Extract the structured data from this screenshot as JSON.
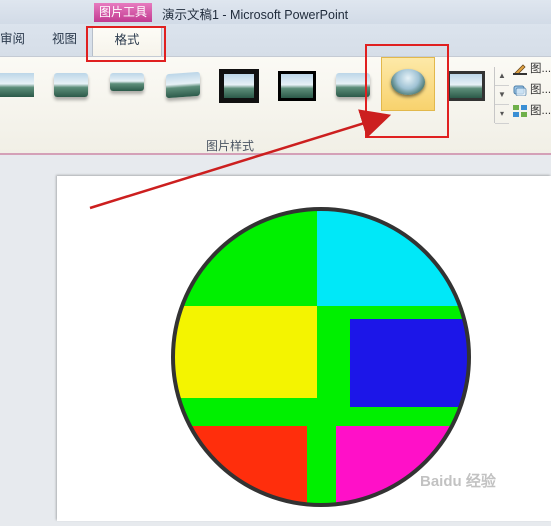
{
  "title_bar": {
    "tools_badge": "图片工具",
    "document_title": "演示文稿1 - Microsoft PowerPoint"
  },
  "tabs": [
    {
      "label": "审阅"
    },
    {
      "label": "视图"
    },
    {
      "label": "格式"
    }
  ],
  "ribbon": {
    "group_label": "图片样式",
    "right_commands": [
      {
        "label": "图..."
      },
      {
        "label": "图..."
      },
      {
        "label": "图..."
      }
    ]
  },
  "slide": {
    "shape": "circle-cropped-picture",
    "colors": {
      "green": "#00f000",
      "cyan": "#00e8f8",
      "yellow": "#f4f400",
      "blue": "#1c16e8",
      "red": "#ff2e0c",
      "magenta": "#ff10c8",
      "outline": "#333333"
    }
  },
  "watermark": "Baidu 经验"
}
